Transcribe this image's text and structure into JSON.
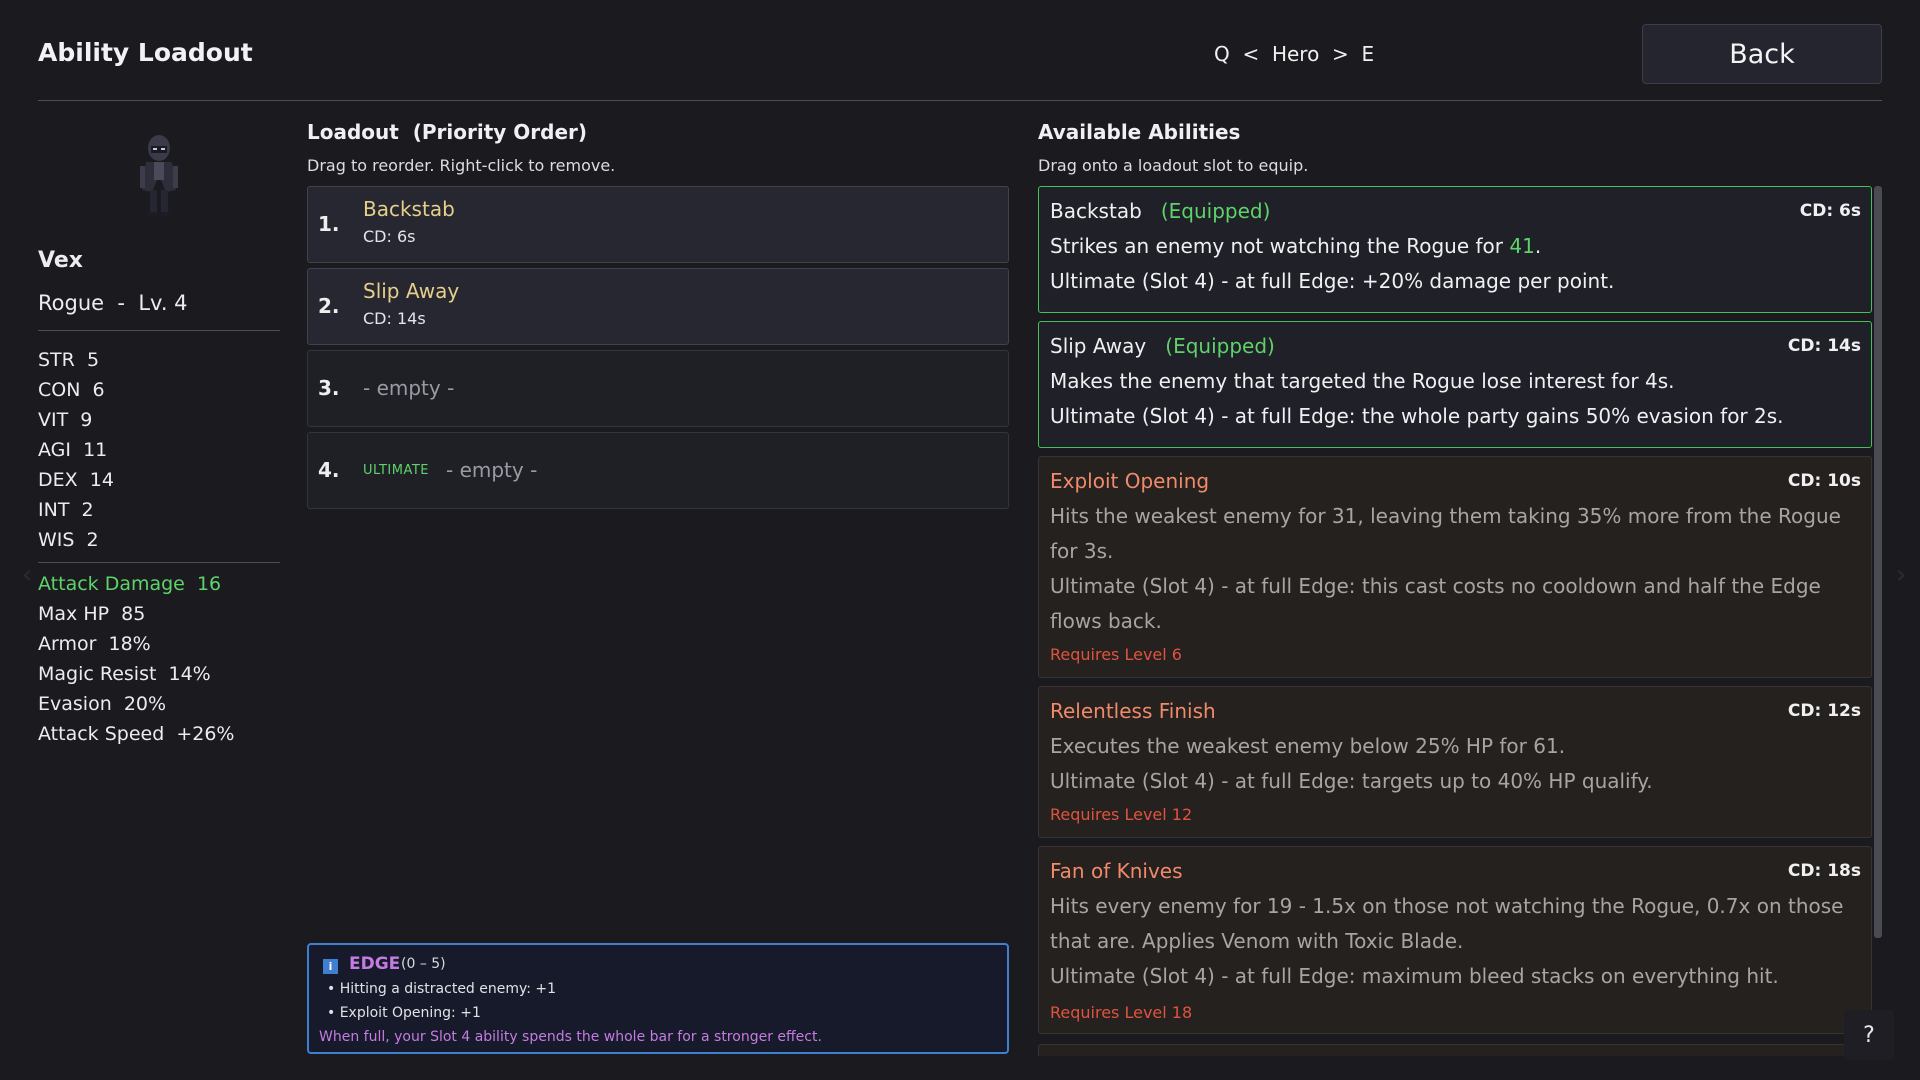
{
  "header": {
    "title": "Ability Loadout",
    "nav_prev_key": "Q",
    "nav_prev_arrow": "<",
    "nav_label": "Hero",
    "nav_next_arrow": ">",
    "nav_next_key": "E",
    "back_label": "Back"
  },
  "character": {
    "avatar_icon": "hooded-rogue-sprite",
    "name": "Vex",
    "class_line": "Rogue  -  Lv. 4",
    "base_stats": [
      {
        "label": "STR  5"
      },
      {
        "label": "CON  6"
      },
      {
        "label": "VIT  9"
      },
      {
        "label": "AGI  11"
      },
      {
        "label": "DEX  14"
      },
      {
        "label": "INT  2"
      },
      {
        "label": "WIS  2"
      }
    ],
    "derived_stats": [
      {
        "label": "Attack Damage  16",
        "highlight": true
      },
      {
        "label": "Max HP  85"
      },
      {
        "label": "Armor  18%"
      },
      {
        "label": "Magic Resist  14%"
      },
      {
        "label": "Evasion  20%"
      },
      {
        "label": "Attack Speed  +26%"
      }
    ]
  },
  "loadout": {
    "title": "Loadout  (Priority Order)",
    "subtitle": "Drag to reorder. Right-click to remove.",
    "slots": [
      {
        "num": "1.",
        "name": "Backstab",
        "cd": "CD: 6s"
      },
      {
        "num": "2.",
        "name": "Slip Away",
        "cd": "CD: 14s"
      },
      {
        "num": "3.",
        "empty": "- empty -"
      },
      {
        "num": "4.",
        "tag": "ULTIMATE",
        "empty": "- empty -"
      }
    ]
  },
  "edge": {
    "icon": "i",
    "name": "EDGE",
    "range": "(0 – 5)",
    "lines": [
      "• Hitting a distracted enemy: +1",
      "• Exploit Opening: +1"
    ],
    "desc": "When full, your Slot 4 ability spends the whole bar for a stronger effect."
  },
  "abilities": {
    "title": "Available Abilities",
    "subtitle": "Drag onto a loadout slot to equip.",
    "items": [
      {
        "name": "Backstab",
        "status": "(Equipped)",
        "cd": "CD: 6s",
        "desc_pre": "Strikes an enemy not watching the Rogue for ",
        "desc_num": "41",
        "desc_post": ".",
        "ult": "Ultimate (Slot 4) - at full Edge: +20% damage per point."
      },
      {
        "name": "Slip Away",
        "status": "(Equipped)",
        "cd": "CD: 14s",
        "desc": "Makes the enemy that targeted the Rogue lose interest for 4s.",
        "ult": "Ultimate (Slot 4) - at full Edge: the whole party gains 50% evasion for 2s."
      },
      {
        "name": "Exploit Opening",
        "cd": "CD: 10s",
        "desc": "Hits the weakest enemy for 31, leaving them taking 35% more from the Rogue for 3s.",
        "ult": "Ultimate (Slot 4) - at full Edge: this cast costs no cooldown and half the Edge flows back.",
        "req": "Requires Level 6"
      },
      {
        "name": "Relentless Finish",
        "cd": "CD: 12s",
        "desc": "Executes the weakest enemy below 25% HP for 61.",
        "ult": "Ultimate (Slot 4) - at full Edge: targets up to 40% HP qualify.",
        "req": "Requires Level 12"
      },
      {
        "name": "Fan of Knives",
        "cd": "CD: 18s",
        "desc": "Hits every enemy for 19 - 1.5x on those not watching the Rogue, 0.7x on those that are. Applies Venom with Toxic Blade.",
        "ult": "Ultimate (Slot 4) - at full Edge: maximum bleed stacks on everything hit.",
        "req": "Requires Level 18"
      }
    ]
  },
  "help_label": "?",
  "colors": {
    "background": "#1a1a1f",
    "equipped_border": "#45c05a",
    "ability_gold": "#e6cf8a",
    "locked_name": "#f08a6a",
    "requirement_red": "#e0533f",
    "edge_purple": "#c47ce0",
    "edge_border": "#3f7fd0"
  }
}
